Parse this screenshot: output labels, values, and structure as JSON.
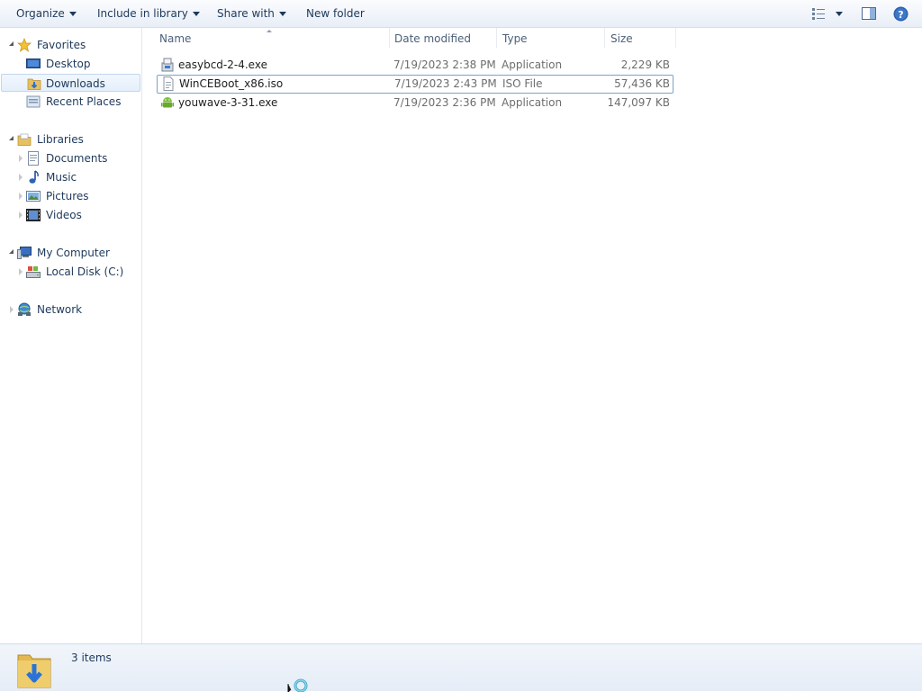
{
  "toolbar": {
    "organize": "Organize",
    "include_in_library": "Include in library",
    "share_with": "Share with",
    "new_folder": "New folder"
  },
  "nav": {
    "favorites": "Favorites",
    "desktop": "Desktop",
    "downloads": "Downloads",
    "recent_places": "Recent Places",
    "libraries": "Libraries",
    "documents": "Documents",
    "music": "Music",
    "pictures": "Pictures",
    "videos": "Videos",
    "my_computer": "My Computer",
    "local_disk": "Local Disk (C:)",
    "network": "Network"
  },
  "columns": {
    "name": "Name",
    "date_modified": "Date modified",
    "type": "Type",
    "size": "Size"
  },
  "files": [
    {
      "name": "easybcd-2-4.exe",
      "date": "7/19/2023 2:38 PM",
      "type": "Application",
      "size": "2,229 KB",
      "icon": "installer-icon"
    },
    {
      "name": "WinCEBoot_x86.iso",
      "date": "7/19/2023 2:43 PM",
      "type": "ISO File",
      "size": "57,436 KB",
      "icon": "iso-file-icon"
    },
    {
      "name": "youwave-3-31.exe",
      "date": "7/19/2023 2:36 PM",
      "type": "Application",
      "size": "147,097 KB",
      "icon": "android-app-icon"
    }
  ],
  "status": {
    "items_count": "3 items"
  },
  "colors": {
    "accent_text": "#1e395b",
    "selection": "#e4effb",
    "focus_border": "#7da2ce"
  }
}
